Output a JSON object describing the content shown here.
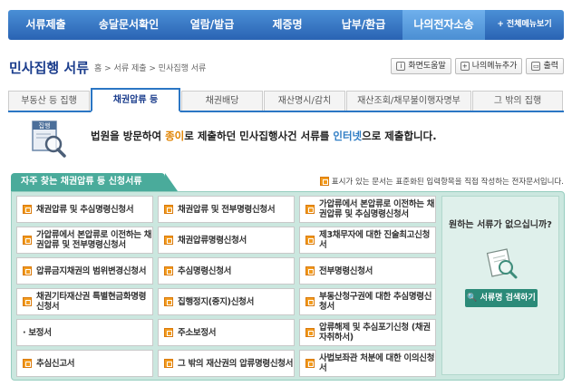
{
  "topnav": {
    "items": [
      "서류제출",
      "송달문서확인",
      "열람/발급",
      "제증명",
      "납부/환급",
      "나의전자소송"
    ],
    "all_menu": "전체메뉴보기"
  },
  "page": {
    "title": "민사집행 서류",
    "breadcrumb": "홈 > 서류 제출 > 민사집행 서류"
  },
  "utils": [
    "화면도움말",
    "나의메뉴추가",
    "출력"
  ],
  "tabs": [
    "부동산 등 집행",
    "채권압류 등",
    "채권배당",
    "재산명시/감치",
    "재산조회/채무불이행자명부",
    "그 밖의 집행"
  ],
  "intro": {
    "part1": "법원을 방문하여 ",
    "part2": "종이",
    "part3": "로 제출하던 민사집행사건 서류를 ",
    "part4": "인터넷",
    "part5": "으로 제출합니다."
  },
  "frequent": {
    "title": "자주 찾는 채권압류 등 신청서류",
    "notice": "표시가 있는 문서는 표준화된 입력항목을 직접 작성하는 전자문서입니다.",
    "docs": [
      [
        "채권압류 및 추심명령신청서",
        "채권압류 및 전부명령신청서",
        "가압류에서 본압류로 이전하는 채권압류 및 추심명령신청서"
      ],
      [
        "가압류에서 본압류로 이전하는 채권압류 및 전부명령신청서",
        "채권압류명령신청서",
        "제3채무자에 대한 진술최고신청서"
      ],
      [
        "압류금지채권의 범위변경신청서",
        "추심명령신청서",
        "전부명령신청서"
      ],
      [
        "채권기타재산권 특별현금화명령신청서",
        "집행정지(중지)신청서",
        "부동산청구권에 대한 추심명령신청서"
      ],
      [
        "· 보정서",
        "주소보정서",
        "압류해제 및 추심포기신청 (채권자취하서)"
      ],
      [
        "추심신고서",
        "그 밖의 재산권의 압류명령신청서",
        "사법보좌관 처분에 대한 이의신청서"
      ]
    ]
  },
  "side": {
    "question": "원하는 서류가 없으십니까?",
    "button": "서류명 검색하기"
  }
}
